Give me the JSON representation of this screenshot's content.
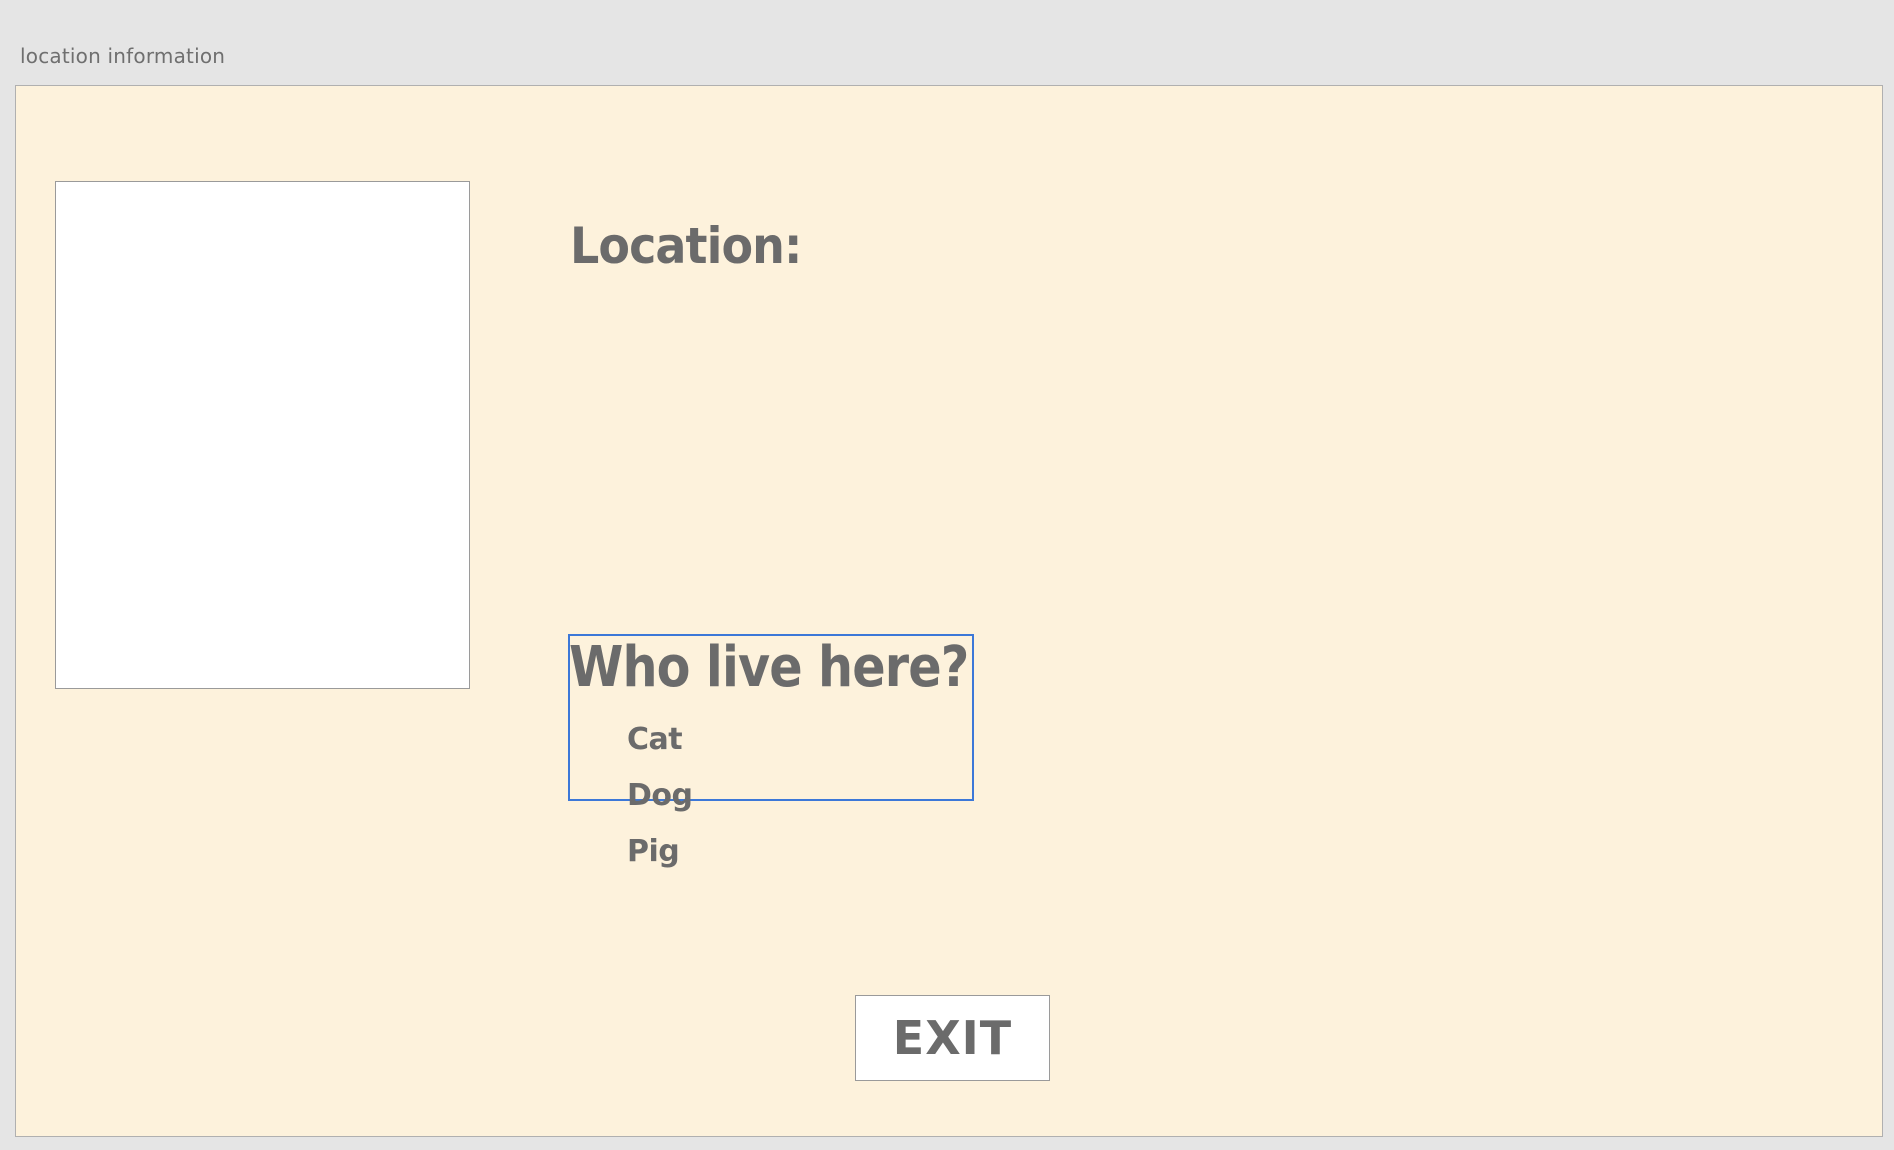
{
  "window": {
    "title": "location information"
  },
  "location": {
    "label": "Location:"
  },
  "residents": {
    "heading": "Who live here?",
    "items": [
      "Cat",
      "Dog",
      "Pig"
    ]
  },
  "actions": {
    "exit_label": "EXIT"
  },
  "colors": {
    "background": "#fdf2dc",
    "text": "#6b6b6b",
    "selection": "#3c78d8"
  }
}
